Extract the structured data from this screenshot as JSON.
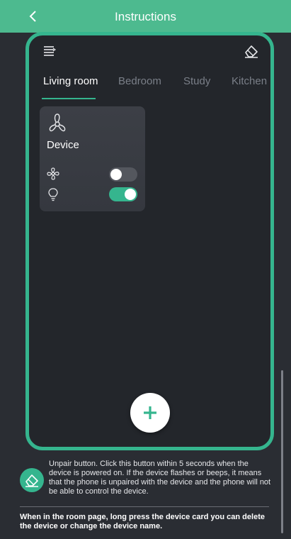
{
  "header": {
    "title": "Instructions",
    "back_icon": "chevron-left-icon",
    "background": "#4dba8f"
  },
  "room_page": {
    "menu_icon": "menu-icon",
    "edit_icon": "eraser-icon",
    "tabs": [
      {
        "label": "Living room",
        "active": true
      },
      {
        "label": "Bedroom",
        "active": false
      },
      {
        "label": "Study",
        "active": false
      },
      {
        "label": "Kitchen",
        "active": false
      }
    ],
    "device_card": {
      "icon": "ceiling-fan-icon",
      "name": "Device",
      "controls": [
        {
          "icon": "fan-icon",
          "state": "off"
        },
        {
          "icon": "bulb-icon",
          "state": "on"
        }
      ]
    },
    "add_button_icon": "plus-icon",
    "accent_color": "#35b58e"
  },
  "instructions": {
    "unpair_icon": "eraser-icon",
    "unpair_text": "Unpair button. Click this button within 5 seconds when the device is powered on. If the device flashes or beeps, it means that the phone is unpaired with the device and the phone will not be able to control the device.",
    "longpress_text": "When in the room page, long press the device card you can delete the device or change the device name."
  }
}
